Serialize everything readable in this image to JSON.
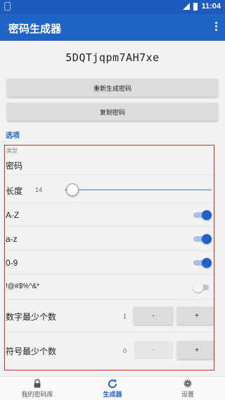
{
  "statusbar": {
    "time": "11:04"
  },
  "appbar": {
    "title": "密码生成器",
    "menu_icon": "more-vert-icon"
  },
  "generated_password": "5DQTjqpm7AH7xe",
  "actions": {
    "regenerate_label": "重新生成密码",
    "copy_label": "复制密码"
  },
  "options": {
    "section_label": "选项",
    "type_caption": "类型",
    "type_value": "密码",
    "length_label": "长度",
    "length_value": "14",
    "length_fraction": 0.05,
    "toggles": [
      {
        "label": "A-Z",
        "on": true
      },
      {
        "label": "a-z",
        "on": true
      },
      {
        "label": "0-9",
        "on": true
      },
      {
        "label": "!@#$%^&*",
        "on": false
      }
    ],
    "min_digits": {
      "label": "数字最少个数",
      "value": "1",
      "minus": "-",
      "plus": "+",
      "minus_enabled": true
    },
    "min_symbols": {
      "label": "符号最少个数",
      "value": "0",
      "minus": "-",
      "plus": "+",
      "minus_enabled": false
    }
  },
  "bottom_nav": [
    {
      "label": "我的密码库",
      "icon": "lock-icon",
      "active": false
    },
    {
      "label": "生成器",
      "icon": "refresh-icon",
      "active": true
    },
    {
      "label": "设置",
      "icon": "gear-icon",
      "active": false
    }
  ],
  "colors": {
    "primary": "#1f64c7",
    "highlight_border": "#c62828"
  }
}
